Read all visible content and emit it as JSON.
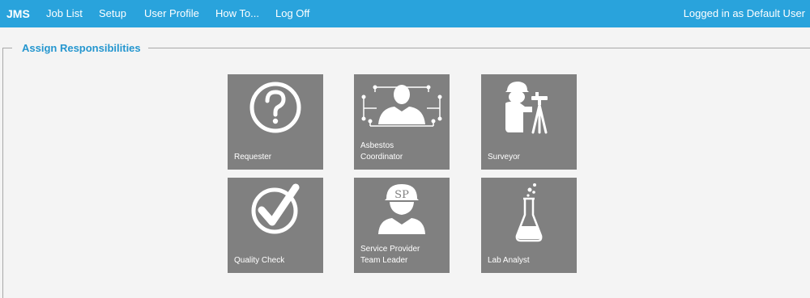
{
  "app": {
    "brand": "JMS"
  },
  "nav": {
    "items": [
      {
        "label": "Job List"
      },
      {
        "label": "Setup"
      },
      {
        "label": "User Profile"
      },
      {
        "label": "How To..."
      },
      {
        "label": "Log Off"
      }
    ],
    "user_info": "Logged in as Default User"
  },
  "section": {
    "title": "Assign Responsibilities"
  },
  "tiles": [
    {
      "label": "Requester",
      "icon": "question-circle-icon"
    },
    {
      "label": "Asbestos\nCoordinator",
      "icon": "coordinator-network-icon"
    },
    {
      "label": "Surveyor",
      "icon": "surveyor-tripod-icon"
    },
    {
      "label": "Quality Check",
      "icon": "check-circle-icon"
    },
    {
      "label": "Service Provider\nTeam Leader",
      "icon": "hardhat-worker-icon",
      "badge": "SP"
    },
    {
      "label": "Lab Analyst",
      "icon": "flask-icon"
    }
  ],
  "colors": {
    "header": "#29a3dc",
    "tile": "#808080",
    "legend": "#2496cf"
  }
}
